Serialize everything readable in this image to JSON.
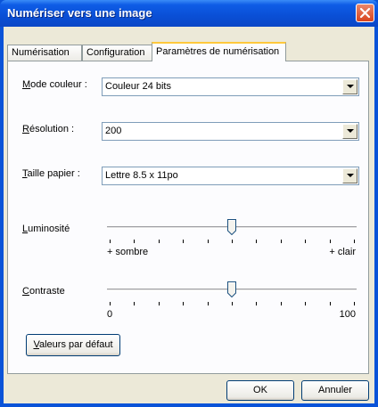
{
  "window": {
    "title": "Numériser vers une image"
  },
  "tabs": [
    {
      "label": "Numérisation"
    },
    {
      "label": "Configuration"
    },
    {
      "label": "Paramètres de numérisation"
    }
  ],
  "settings": {
    "color_mode": {
      "label_first": "M",
      "label_rest": "ode couleur :",
      "value": "Couleur 24 bits"
    },
    "resolution": {
      "label_first": "R",
      "label_rest": "ésolution :",
      "value": "200"
    },
    "paper_size": {
      "label_first": "T",
      "label_rest": "aille papier :",
      "value": "Lettre 8.5 x 11po"
    }
  },
  "brightness": {
    "label_first": "L",
    "label_rest": "uminosité",
    "min_label": "+ sombre",
    "max_label": "+ clair",
    "level": 0.5
  },
  "contrast": {
    "label_first": "C",
    "label_rest": "ontraste",
    "min_label": "0",
    "max_label": "100",
    "level": 0.5
  },
  "buttons": {
    "defaults_first": "V",
    "defaults_rest": "aleurs par défaut",
    "ok": "OK",
    "cancel": "Annuler"
  },
  "colors": {
    "titlebar": "#0a4fd6",
    "face": "#ece9d8",
    "close": "#d9441d"
  },
  "icons": {
    "close": "close-icon",
    "dropdown": "chevron-down-icon",
    "slider_thumb": "slider-thumb-icon"
  }
}
